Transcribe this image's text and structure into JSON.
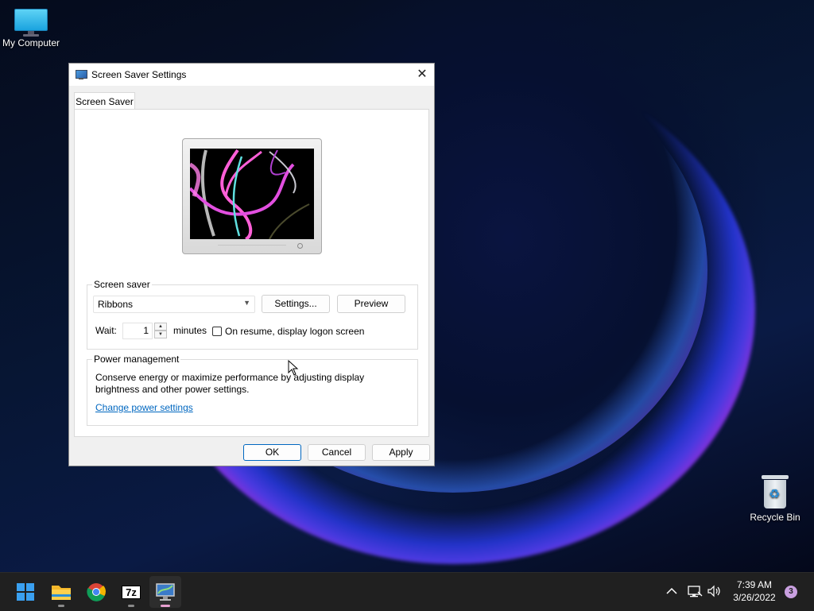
{
  "desktop": {
    "icons": [
      {
        "label": "My Computer"
      },
      {
        "label": "Recycle Bin"
      }
    ]
  },
  "dialog": {
    "title": "Screen Saver Settings",
    "close_glyph": "✕",
    "tab_label": "Screen Saver",
    "screen_saver_group": {
      "label": "Screen saver",
      "selected": "Ribbons",
      "settings_button": "Settings...",
      "preview_button": "Preview",
      "wait_label": "Wait:",
      "wait_value": "1",
      "minutes_label": "minutes",
      "resume_checkbox_label": "On resume, display logon screen",
      "resume_checked": false
    },
    "power_group": {
      "label": "Power management",
      "description_line1": "Conserve energy or maximize performance by adjusting display",
      "description_line2": "brightness and other power settings.",
      "link": "Change power settings"
    },
    "buttons": {
      "ok": "OK",
      "cancel": "Cancel",
      "apply": "Apply"
    }
  },
  "taskbar": {
    "pinned": [
      {
        "name": "start-icon"
      },
      {
        "name": "file-explorer-icon"
      },
      {
        "name": "chrome-icon"
      },
      {
        "name": "7zip-icon",
        "text": "7z"
      },
      {
        "name": "screen-saver-settings-icon",
        "active": true
      }
    ],
    "tray": {
      "clock_time": "7:39 AM",
      "clock_date": "3/26/2022",
      "notification_count": "3"
    }
  },
  "colors": {
    "accent": "#0067c0",
    "taskbar_bg": "#202020",
    "active_indicator": "#e8a0d0"
  }
}
